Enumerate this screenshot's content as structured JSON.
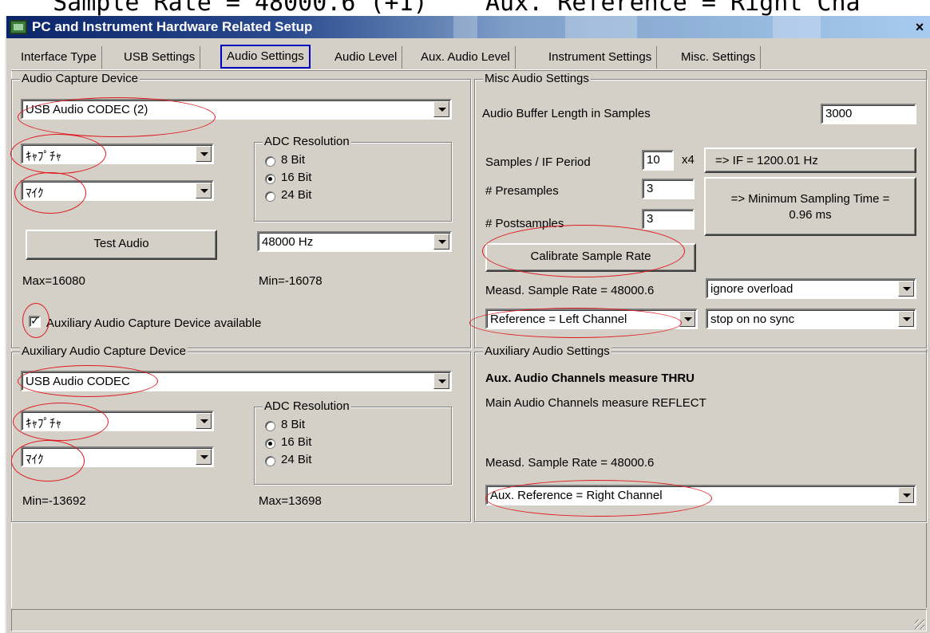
{
  "caption_top": "  Sample Rate = 48000.6 (+1)    Aux. Reference = Right Cha",
  "window": {
    "title": "PC and Instrument Hardware Related Setup",
    "close_label": "×"
  },
  "tabs": [
    {
      "label": "Interface Type"
    },
    {
      "label": "USB Settings"
    },
    {
      "label": "Audio Settings"
    },
    {
      "label": "Audio Level"
    },
    {
      "label": "Aux. Audio Level"
    },
    {
      "label": "Instrument Settings"
    },
    {
      "label": "Misc. Settings"
    }
  ],
  "capture": {
    "legend": "Audio Capture Device",
    "device": "USB Audio CODEC  (2)",
    "kind": "ｷｬﾌﾟﾁｬ",
    "source": "ﾏｲｸ",
    "adc_legend": "ADC Resolution",
    "adc_options": [
      "8 Bit",
      "16 Bit",
      "24 Bit"
    ],
    "adc_selected": "16 Bit",
    "test_button": "Test Audio",
    "rate": "48000 Hz",
    "max_label": "Max=16080",
    "min_label": "Min=-16078",
    "aux_checkbox_label": "Auxiliary Audio Capture Device available",
    "aux_checked": true
  },
  "misc": {
    "legend": "Misc Audio Settings",
    "buffer_label": "Audio Buffer Length in Samples",
    "buffer_value": "3000",
    "samples_if_label": "Samples / IF Period",
    "samples_if_value": "10",
    "x4_label": "x4",
    "if_display": "=> IF =   1200.01 Hz",
    "presamples_label": "# Presamples",
    "presamples_value": "3",
    "postsamples_label": "# Postsamples",
    "postsamples_value": "3",
    "min_sampling_line1": "=> Minimum Sampling Time =",
    "min_sampling_line2": "0.96 ms",
    "calibrate_button": "Calibrate Sample Rate",
    "measured_rate": "Measd. Sample Rate = 48000.6",
    "overload": "ignore overload",
    "reference": "Reference = Left Channel",
    "sync": "stop on no sync"
  },
  "aux_capture": {
    "legend": "Auxiliary Audio Capture Device",
    "device": "USB Audio CODEC",
    "kind": "ｷｬﾌﾟﾁｬ",
    "source": "ﾏｲｸ",
    "adc_legend": "ADC Resolution",
    "adc_options": [
      "8 Bit",
      "16 Bit",
      "24 Bit"
    ],
    "adc_selected": "16 Bit",
    "min_label": "Min=-13692",
    "max_label": "Max=13698"
  },
  "aux_settings": {
    "legend": "Auxiliary Audio Settings",
    "thru_text": "Aux. Audio Channels measure THRU",
    "reflect_text": "Main Audio Channels measure REFLECT",
    "measured_rate": "Measd. Sample Rate = 48000.6",
    "reference": "Aux. Reference = Right Channel"
  },
  "colors": {
    "highlight_ellipse": "#e0191e",
    "active_tab_border": "#0000c0",
    "title_bar": "#0a246a"
  }
}
